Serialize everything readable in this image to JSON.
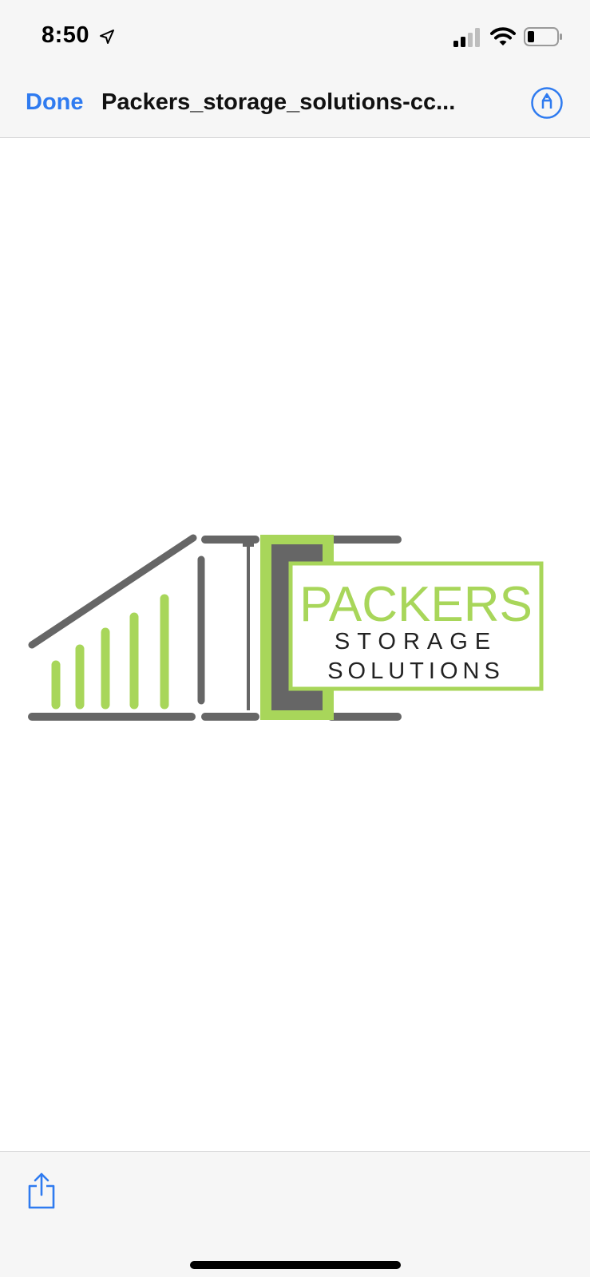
{
  "status_bar": {
    "time": "8:50",
    "icons": [
      "location-arrow-icon",
      "cellular-signal-icon",
      "wifi-icon",
      "battery-icon"
    ]
  },
  "nav_bar": {
    "done_label": "Done",
    "title": "Packers_storage_solutions-cc...",
    "markup_icon": "markup-pen-icon"
  },
  "logo": {
    "brand_word": "PACKERS",
    "line_two": "STORAGE",
    "line_three": "SOLUTIONS",
    "colors": {
      "green": "#a8d65a",
      "gray": "#666666"
    }
  },
  "bottom_bar": {
    "share_icon": "share-icon"
  },
  "colors": {
    "accent": "#2f7bf0",
    "bar_background": "#f6f6f6"
  }
}
